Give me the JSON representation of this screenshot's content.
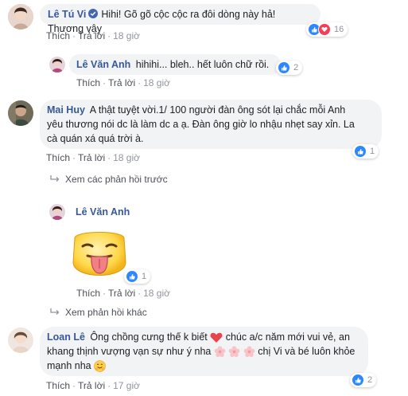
{
  "comments": [
    {
      "name": "Lê Tú Vi",
      "text": "Hihi! Gõ gõ cộc cộc ra đôi dòng này hả! Thương vậy",
      "like_label": "Thích",
      "reply_label": "Trả lời",
      "time": "18 giờ",
      "reaction_count": "16",
      "reaction_icons": [
        "like-icon",
        "love-icon"
      ]
    },
    {
      "name": "Lê Văn Anh",
      "text": "hihihi... bleh.. hết luôn chữ rồi.",
      "like_label": "Thích",
      "reply_label": "Trả lời",
      "time": "18 giờ",
      "reaction_count": "2",
      "reaction_icons": [
        "like-icon"
      ]
    },
    {
      "name": "Mai Huy",
      "text_lines": [
        "A thật tuyệt vời.1/ 100 người đàn ông sót lại chắc mỗi Anh",
        "yêu thương nói dc là làm dc a ạ. Đàn ông giờ lo nhậu nhẹt say xỉn. La",
        "cà quán xá quá trời à."
      ],
      "like_label": "Thích",
      "reply_label": "Trả lời",
      "time": "18 giờ",
      "reaction_count": "1",
      "reaction_icons": [
        "like-icon"
      ]
    },
    {
      "name": "Lê Văn Anh",
      "sticker": "tongue-out-face-sticker",
      "like_label": "Thích",
      "reply_label": "Trả lời",
      "time": "18 giờ",
      "reaction_count": "1",
      "reaction_icons": [
        "like-icon"
      ]
    },
    {
      "name": "Loan Lê",
      "text_parts": {
        "l1a": "Ông chồng cưng thế k biết",
        "l1b": "chúc a/c năm mới vui vẻ, an",
        "l2a": "khang thịnh vượng vạn sự như ý nha",
        "l2b": "chị Vi và bé luôn khỏe",
        "l3": "mạnh nha"
      },
      "like_label": "Thích",
      "reply_label": "Trả lời",
      "time": "17 giờ",
      "reaction_count": "2",
      "reaction_icons": [
        "like-icon"
      ]
    }
  ],
  "previous_replies_label": "Xem các phản hồi trước",
  "more_replies_label": "Xem phản hồi khác",
  "colors": {
    "name": "#365899",
    "bubble": "#f2f3f5",
    "like": "#2d88ff",
    "love": "#f33e58",
    "meta": "#90949c"
  }
}
